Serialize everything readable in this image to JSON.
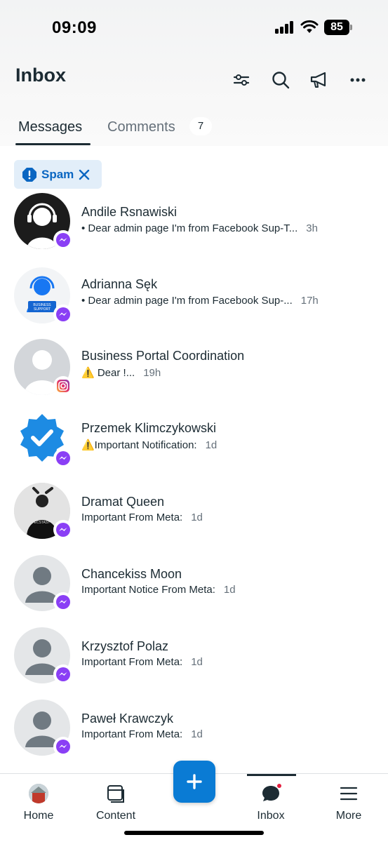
{
  "status_bar": {
    "time": "09:09",
    "battery": "85"
  },
  "header": {
    "title": "Inbox",
    "icons": [
      "filter-icon",
      "search-icon",
      "megaphone-icon",
      "more-icon"
    ]
  },
  "tabs": [
    {
      "label": "Messages",
      "active": true
    },
    {
      "label": "Comments",
      "count": "7",
      "active": false
    }
  ],
  "filter_chip": {
    "label": "Spam",
    "icon": "alert-icon",
    "close_icon": "close-icon"
  },
  "conversations": [
    {
      "name": "Andile Rsnawiski",
      "preview": "• Dear admin page I'm from Facebook Sup-T...",
      "time": "3h",
      "channel": "messenger",
      "avatar": "headset-dark"
    },
    {
      "name": "Adrianna Sęk",
      "preview": "• Dear admin page I'm from Facebook Sup-...",
      "time": "17h",
      "channel": "messenger",
      "avatar": "business-support"
    },
    {
      "name": "Business Portal Coordination",
      "preview": "⚠️ Dear !...",
      "time": "19h",
      "channel": "instagram",
      "avatar": "default-gray"
    },
    {
      "name": "Przemek Klimczykowski",
      "preview": "⚠️Important Notification:",
      "time": "1d",
      "channel": "messenger",
      "avatar": "verified-badge"
    },
    {
      "name": "Dramat Queen",
      "preview": "Important From Meta:",
      "time": "1d",
      "channel": "messenger",
      "avatar": "photo-person"
    },
    {
      "name": "Chancekiss Moon",
      "preview": "Important Notice From Meta:",
      "time": "1d",
      "channel": "messenger",
      "avatar": "default-person"
    },
    {
      "name": "Krzysztof Polaz",
      "preview": "Important From Meta:",
      "time": "1d",
      "channel": "messenger",
      "avatar": "default-person"
    },
    {
      "name": "Paweł Krawczyk",
      "preview": "Important From Meta:",
      "time": "1d",
      "channel": "messenger",
      "avatar": "default-person"
    }
  ],
  "bottom_nav": [
    {
      "label": "Home",
      "icon": "profile-photo-icon"
    },
    {
      "label": "Content",
      "icon": "content-icon"
    },
    {
      "label": "Inbox",
      "icon": "chat-bubble-icon",
      "active": true
    },
    {
      "label": "More",
      "icon": "hamburger-icon"
    }
  ],
  "fab": {
    "icon": "plus-icon"
  },
  "colors": {
    "accent": "#0a7bd4",
    "chip_bg": "#e2eef9",
    "chip_text": "#0a66c2",
    "notification_dot": "#e41e3f"
  }
}
